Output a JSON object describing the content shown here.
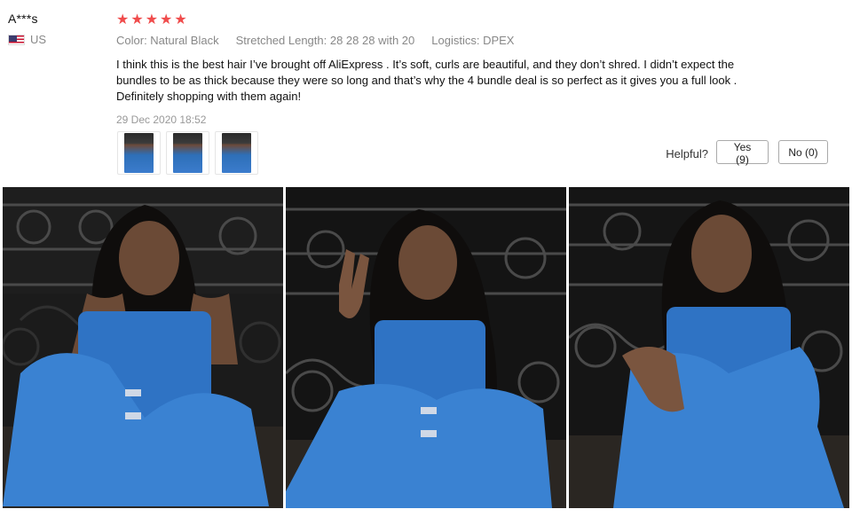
{
  "user": {
    "name": "A***s",
    "country": "US",
    "flag_icon": "us-flag-icon"
  },
  "review": {
    "rating": 5,
    "rating_max": 5,
    "star_color": "#f04c4c",
    "meta": {
      "color": "Color: Natural Black",
      "length": "Stretched Length: 28 28 28 with 20",
      "logistics": "Logistics: DPEX"
    },
    "content": "I think this is the best hair I’ve brought off AliExpress . It’s soft, curls are beautiful, and they don’t shred. I didn’t expect the bundles to be as thick because they were so long and that’s why the 4 bundle deal is so perfect as it gives you a full look . Definitely shopping with them again!",
    "date": "29 Dec 2020 18:52",
    "thumbnails": [
      "review-photo-1",
      "review-photo-2",
      "review-photo-3"
    ]
  },
  "helpful": {
    "label": "Helpful?",
    "yes_label": "Yes (9)",
    "no_label": "No (0)"
  },
  "gallery": {
    "photos": [
      "photo-1",
      "photo-2",
      "photo-3"
    ]
  }
}
